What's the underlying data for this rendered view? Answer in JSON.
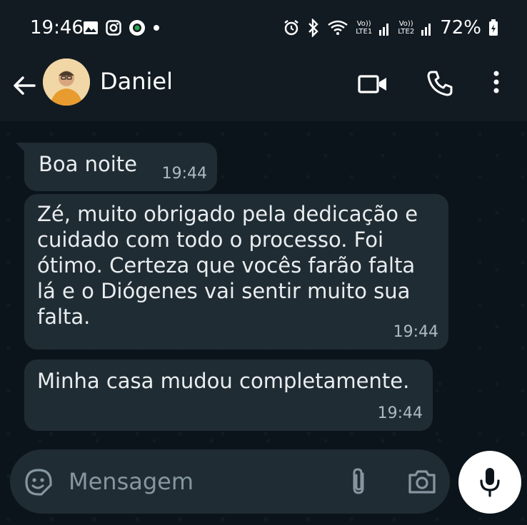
{
  "status_bar": {
    "time": "19:46",
    "battery": "72%",
    "left_icons": [
      "gallery-icon",
      "instagram-icon",
      "app-icon",
      "dot-icon"
    ],
    "right_icons": [
      "alarm-icon",
      "bluetooth-icon",
      "wifi-icon",
      "volte-lte1-icon",
      "signal-icon",
      "volte-lte2-icon",
      "signal-icon",
      "battery-icon"
    ],
    "volte1_label": "Vo))",
    "lte1_label": "LTE1",
    "volte2_label": "Vo))",
    "lte2_label": "LTE2"
  },
  "header": {
    "contact_name": "Daniel",
    "icons": [
      "back-arrow-icon",
      "video-call-icon",
      "phone-call-icon",
      "more-options-icon"
    ]
  },
  "messages": [
    {
      "text": "Boa noite",
      "time": "19:44"
    },
    {
      "text": "Zé, muito obrigado pela dedicação e cuidado com todo o processo. Foi ótimo. Certeza que vocês farão falta lá e o Diógenes vai sentir muito sua falta.",
      "time": "19:44"
    },
    {
      "text": "Minha casa mudou completamente.",
      "time": "19:44"
    }
  ],
  "composer": {
    "placeholder": "Mensagem",
    "icons": [
      "sticker-icon",
      "attach-icon",
      "camera-icon",
      "mic-icon"
    ]
  },
  "colors": {
    "background": "#0b141a",
    "bar": "#121b22",
    "bubble": "#202c33",
    "text": "#e9edef",
    "muted": "#8696a0"
  }
}
